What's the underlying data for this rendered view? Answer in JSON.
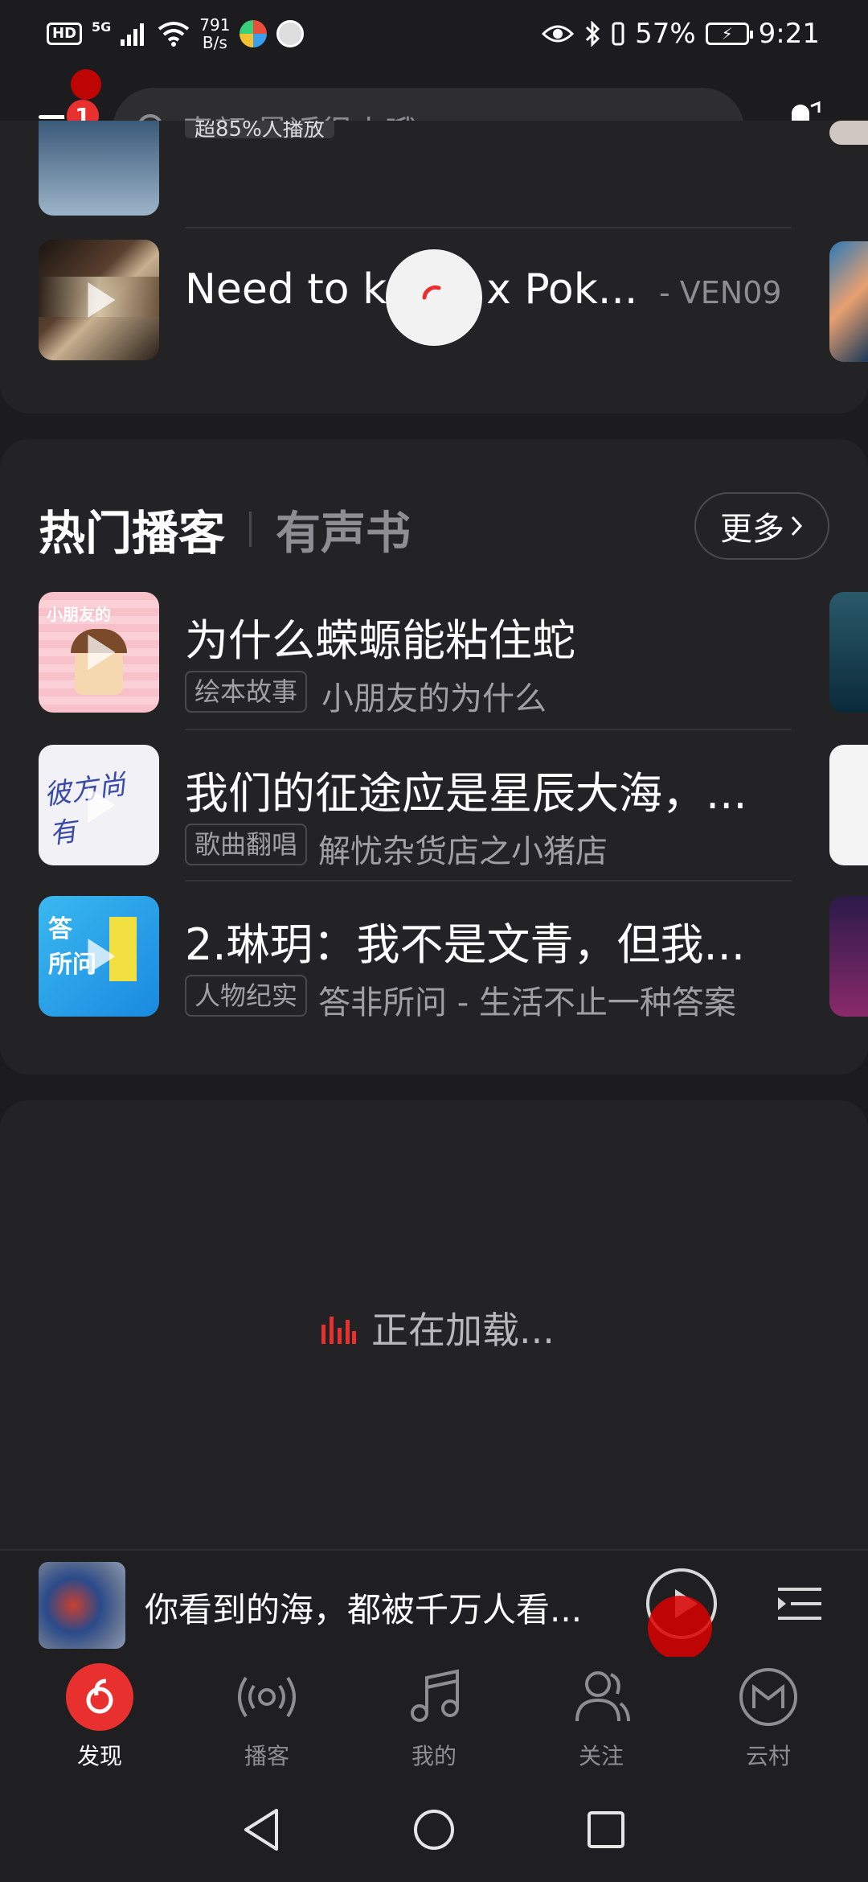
{
  "status_bar": {
    "hd": "HD",
    "network_type": "5G",
    "speed_value": "791",
    "speed_unit": "B/s",
    "battery_percent": "57%",
    "time": "9:21"
  },
  "header": {
    "notification_count": "1",
    "search_placeholder": "素颜 最近很火哦"
  },
  "partial_card": {
    "cut_tag": "超85%人播放",
    "song": {
      "title": "Need to know x Pok...",
      "artist": "- VEN09"
    }
  },
  "podcast_section": {
    "tab_active": "热门播客",
    "tab_inactive": "有声书",
    "more_label": "更多",
    "items": [
      {
        "title": "为什么蝾螈能粘住蛇",
        "tag": "绘本故事",
        "subtitle": "小朋友的为什么"
      },
      {
        "title": "我们的征途应是星辰大海，...",
        "tag": "歌曲翻唱",
        "subtitle": "解忧杂货店之小猪店"
      },
      {
        "title": "2.琳玥：我不是文青，但我...",
        "tag": "人物纪实",
        "subtitle": "答非所问 - 生活不止一种答案"
      }
    ]
  },
  "loading": {
    "text": "正在加载..."
  },
  "mini_player": {
    "title": "你看到的海，都被千万人看..."
  },
  "bottom_nav": {
    "items": [
      {
        "label": "发现",
        "icon": "netease-logo-icon",
        "active": true
      },
      {
        "label": "播客",
        "icon": "podcast-icon",
        "active": false
      },
      {
        "label": "我的",
        "icon": "music-note-icon",
        "active": false
      },
      {
        "label": "关注",
        "icon": "people-icon",
        "active": false
      },
      {
        "label": "云村",
        "icon": "cloud-village-icon",
        "active": false
      }
    ]
  },
  "colors": {
    "accent": "#e8312f",
    "background": "#1c1c1e",
    "card": "#232325"
  }
}
